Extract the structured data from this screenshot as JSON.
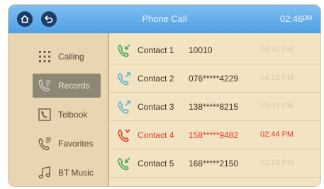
{
  "header": {
    "title": "Phone Call",
    "clock": "02:46ᴰᴹ"
  },
  "sidebar": {
    "items": [
      {
        "label": "Calling",
        "icon": "keypad-icon",
        "active": false
      },
      {
        "label": "Records",
        "icon": "call-records-icon",
        "active": true
      },
      {
        "label": "Telbook",
        "icon": "phonebook-icon",
        "active": false
      },
      {
        "label": "Favorites",
        "icon": "favorites-icon",
        "active": false
      },
      {
        "label": "BT Music",
        "icon": "music-note-icon",
        "active": false
      }
    ]
  },
  "records": [
    {
      "name": "Contact 1",
      "number": "10010",
      "time": "04:40 PM",
      "type": "received"
    },
    {
      "name": "Contact 2",
      "number": "076*****4229",
      "time": "04:15 PM",
      "type": "dialed"
    },
    {
      "name": "Contact 3",
      "number": "138*****8215",
      "time": "03:01 PM",
      "type": "dialed"
    },
    {
      "name": "Contact 4",
      "number": "158*****9482",
      "time": "02:44 PM",
      "type": "missed"
    },
    {
      "name": "Contact 5",
      "number": "168*****2150",
      "time": "02:18 PM",
      "type": "received"
    }
  ],
  "colors": {
    "accent": "#4f9fe4",
    "missed": "#e0392b",
    "received": "#3aa84a",
    "dialed": "#5ab0d0"
  }
}
